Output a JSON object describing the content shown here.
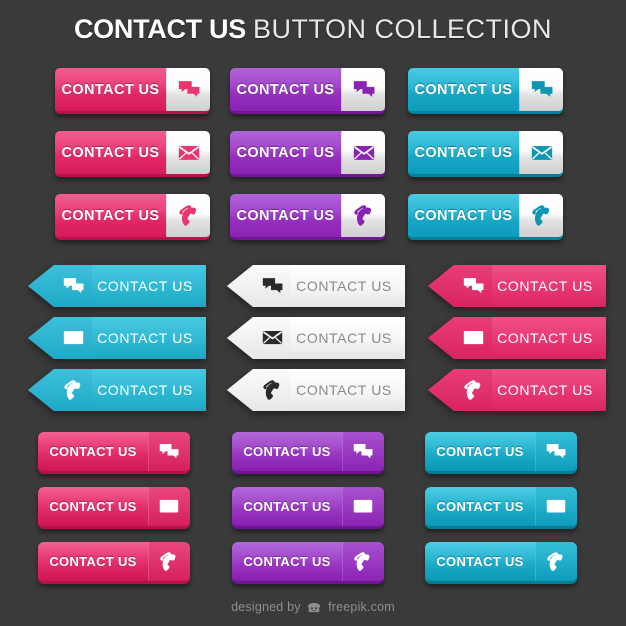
{
  "background_color": "#3a3a3a",
  "header": {
    "title_bold": "CONTACT US",
    "title_light": "BUTTON COLLECTION"
  },
  "label": "CONTACT US",
  "palette": {
    "pink": "#e8376f",
    "pink_dark": "#d01e58",
    "pink_light": "#f0598a",
    "purple": "#9b3fc4",
    "purple_dark": "#7d21a8",
    "purple_light": "#b060d8",
    "teal": "#26b3ce",
    "teal_dark": "#0e96b4",
    "teal_light": "#44c8e0",
    "white": "#f4f4f4",
    "white_dark": "#d8d8d8",
    "icon_dark": "#2b2b2b",
    "text_gray": "#8a8a8a"
  },
  "icons": {
    "chat": "chat-bubbles-icon",
    "mail": "envelope-icon",
    "phone": "phone-handset-icon"
  },
  "groups": [
    {
      "style": "split-white-panel",
      "style_id": "s1",
      "rows": [
        {
          "icon": "chat",
          "buttons": [
            {
              "color": "pink",
              "label": "CONTACT US"
            },
            {
              "color": "purple",
              "label": "CONTACT US"
            },
            {
              "color": "teal",
              "label": "CONTACT US"
            }
          ]
        },
        {
          "icon": "mail",
          "buttons": [
            {
              "color": "pink",
              "label": "CONTACT US"
            },
            {
              "color": "purple",
              "label": "CONTACT US"
            },
            {
              "color": "teal",
              "label": "CONTACT US"
            }
          ]
        },
        {
          "icon": "phone",
          "buttons": [
            {
              "color": "pink",
              "label": "CONTACT US"
            },
            {
              "color": "purple",
              "label": "CONTACT US"
            },
            {
              "color": "teal",
              "label": "CONTACT US"
            }
          ]
        }
      ]
    },
    {
      "style": "ribbon-arrow",
      "style_id": "s2",
      "rows": [
        {
          "icon": "chat",
          "buttons": [
            {
              "color": "teal",
              "label": "CONTACT US"
            },
            {
              "color": "white",
              "label": "CONTACT US"
            },
            {
              "color": "pink",
              "label": "CONTACT US"
            }
          ]
        },
        {
          "icon": "mail",
          "buttons": [
            {
              "color": "teal",
              "label": "CONTACT US"
            },
            {
              "color": "white",
              "label": "CONTACT US"
            },
            {
              "color": "pink",
              "label": "CONTACT US"
            }
          ]
        },
        {
          "icon": "phone",
          "buttons": [
            {
              "color": "teal",
              "label": "CONTACT US"
            },
            {
              "color": "white",
              "label": "CONTACT US"
            },
            {
              "color": "pink",
              "label": "CONTACT US"
            }
          ]
        }
      ]
    },
    {
      "style": "solid-pill",
      "style_id": "s3",
      "rows": [
        {
          "icon": "chat",
          "buttons": [
            {
              "color": "pink",
              "label": "CONTACT US"
            },
            {
              "color": "purple",
              "label": "CONTACT US"
            },
            {
              "color": "teal",
              "label": "CONTACT US"
            }
          ]
        },
        {
          "icon": "mail",
          "buttons": [
            {
              "color": "pink",
              "label": "CONTACT US"
            },
            {
              "color": "purple",
              "label": "CONTACT US"
            },
            {
              "color": "teal",
              "label": "CONTACT US"
            }
          ]
        },
        {
          "icon": "phone",
          "buttons": [
            {
              "color": "pink",
              "label": "CONTACT US"
            },
            {
              "color": "purple",
              "label": "CONTACT US"
            },
            {
              "color": "teal",
              "label": "CONTACT US"
            }
          ]
        }
      ]
    }
  ],
  "footer": {
    "prefix": "designed by",
    "brand": "freepik.com",
    "logo": "freepik-crown-logo"
  }
}
